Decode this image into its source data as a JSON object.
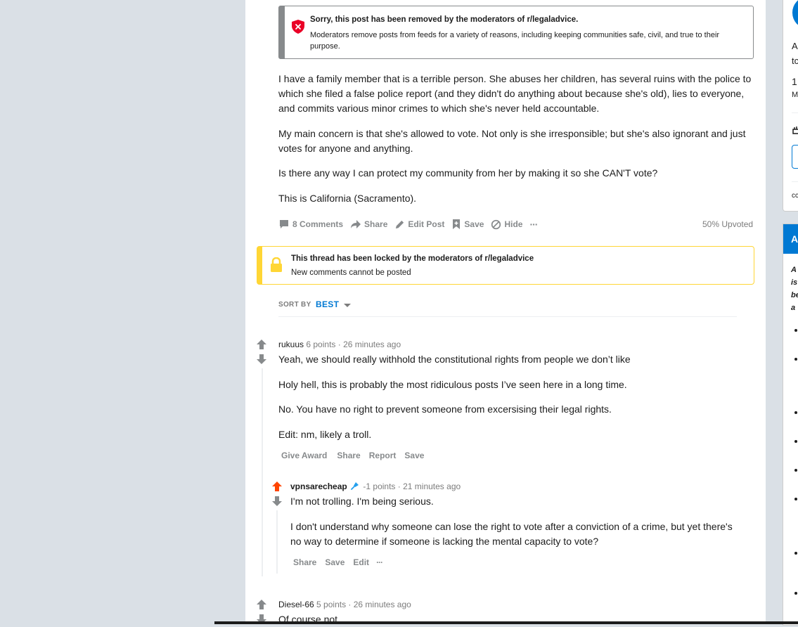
{
  "removed_notice": {
    "title": "Sorry, this post has been removed by the moderators of r/legaladvice.",
    "description": "Moderators remove posts from feeds for a variety of reasons, including keeping communities safe, civil, and true to their purpose."
  },
  "post": {
    "paragraphs": [
      "I have a family member that is a terrible person. She abuses her children, has several ruins with the police to which she filed a false police report (and they didn't do anything about because she's old), lies to everyone, and commits various minor crimes to which she's never held accountable.",
      "My main concern is that she's allowed to vote. Not only is she irresponsible; but she's also ignorant and just votes for anyone and anything.",
      "Is there any way I can protect my community from her by making it so she CAN'T vote?",
      "This is California (Sacramento)."
    ],
    "actions": {
      "comments": "8 Comments",
      "share": "Share",
      "edit": "Edit Post",
      "save": "Save",
      "hide": "Hide",
      "more": "···"
    },
    "upvoted": "50% Upvoted"
  },
  "locked_notice": {
    "title": "This thread has been locked by the moderators of r/legaladvice",
    "description": "New comments cannot be posted"
  },
  "sort": {
    "label": "SORT BY",
    "value": "BEST"
  },
  "comments": [
    {
      "author": "rukuus",
      "points": "6 points",
      "time": "· 26 minutes ago",
      "paragraphs": [
        "Yeah, we should really withhold the constitutional rights from people we don’t like",
        "Holy hell, this is probably the most ridiculous posts I’ve seen here in a long time.",
        "No. You have no right to prevent someone from excersising their legal rights.",
        "Edit: nm, likely a troll."
      ],
      "actions": [
        "Give Award",
        "Share",
        "Report",
        "Save"
      ]
    },
    {
      "author": "vpnsarecheap",
      "points": "-1 points",
      "time": "· 21 minutes ago",
      "paragraphs": [
        "I'm not trolling. I'm being serious.",
        "I don't understand why someone can lose the right to vote after a conviction of a crime, but yet there's no way to determine if someone is lacking the mental capacity to vote?"
      ],
      "actions": [
        "Share",
        "Save",
        "Edit",
        "···"
      ]
    },
    {
      "author": "Diesel-66",
      "points": "5 points",
      "time": "· 26 minutes ago",
      "paragraphs": [
        "Of course not"
      ]
    }
  ],
  "sidebar": {
    "card1": [
      "A",
      "tc",
      "1",
      "M",
      "cc"
    ],
    "card2_header": "A",
    "card2_lines": [
      "A",
      "is",
      "be",
      "a"
    ]
  },
  "colors": {
    "upvote_active": "#ff4500",
    "link_blue": "#0079d3",
    "removed_red": "#ea0027",
    "lock_yellow": "#ffd635"
  }
}
